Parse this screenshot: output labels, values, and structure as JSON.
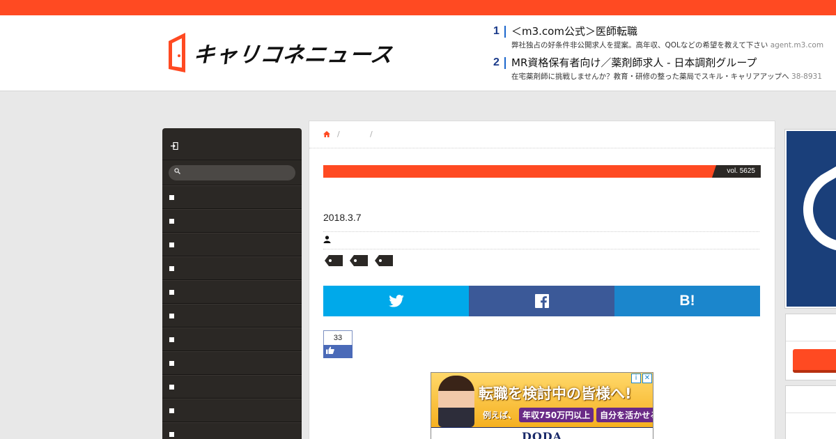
{
  "site": {
    "logo_text": "キャリコネニュース",
    "accent_color": "#ff4a22",
    "dark_color": "#2b2825"
  },
  "ads": [
    {
      "num": "1",
      "title": "＜m3.com公式＞医師転職",
      "desc": "弊社独占の好条件非公開求人を提案。高年収、QOLなどの希望を教えて下さい",
      "url": "agent.m3.com"
    },
    {
      "num": "2",
      "title": "MR資格保有者向け／薬剤師求人 - 日本調剤グループ",
      "desc": "在宅薬剤師に挑戦しませんか？教育・研修の整った薬局でスキル・キャリアアップへ",
      "url": "38-8931"
    }
  ],
  "sidebar": {
    "login_icon": "login-icon",
    "search_icon": "search-icon",
    "item_count": 11
  },
  "breadcrumb": {
    "home_icon": "home-icon",
    "separators": [
      "/",
      "/"
    ]
  },
  "article": {
    "vol": "vol. 5625",
    "date": "2018.3.7",
    "author_icon": "user-icon",
    "tag_count": 3
  },
  "share": {
    "twitter_icon": "twitter-icon",
    "facebook_icon": "facebook-icon",
    "hatena_label": "B!"
  },
  "like": {
    "count": "33",
    "icon": "thumbs-up-icon"
  },
  "banner": {
    "title": "転職を検討中の皆様へ!",
    "example": "例えば、",
    "pill1": "年収750万円以上",
    "pill2": "自分を活かせる職場",
    "brand": "DODA",
    "info_icon": "i",
    "close_icon": "✕"
  }
}
